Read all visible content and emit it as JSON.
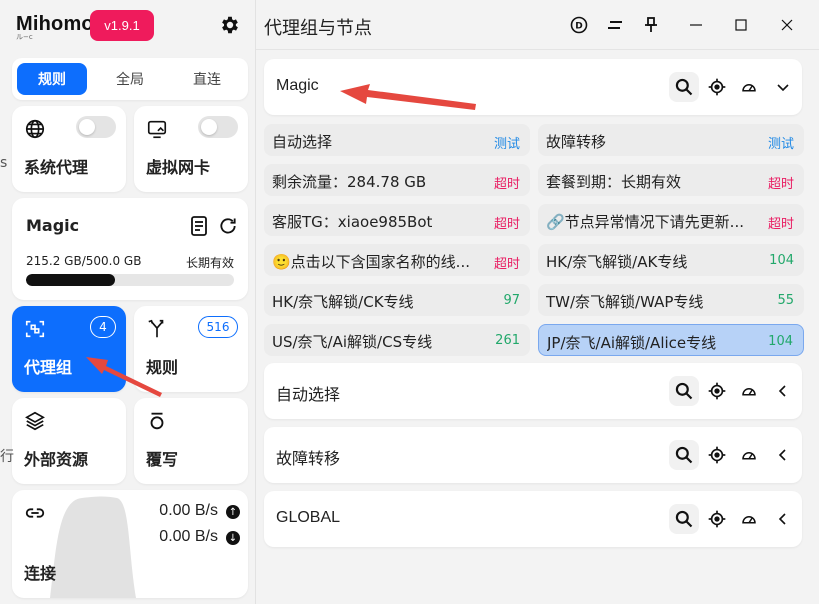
{
  "app": {
    "brand": "Mihomo",
    "brand_sub": "ル−c",
    "version": "v1.9.1"
  },
  "modes": [
    {
      "label": "规则",
      "active": true
    },
    {
      "label": "全局",
      "active": false
    },
    {
      "label": "直连",
      "active": false
    }
  ],
  "system_proxy": {
    "label": "系统代理",
    "enabled": false
  },
  "tun": {
    "label": "虚拟网卡",
    "enabled": false
  },
  "subscription": {
    "name": "Magic",
    "usage": "215.2 GB/500.0 GB",
    "expire": "长期有效",
    "used_fraction": 0.43
  },
  "proxy_groups_card": {
    "label": "代理组",
    "count": "4"
  },
  "rules_card": {
    "label": "规则",
    "count": "516"
  },
  "resources_card": {
    "label": "外部资源"
  },
  "override_card": {
    "label": "覆写"
  },
  "connections_card": {
    "label": "连接",
    "upload": "0.00 B/s",
    "download": "0.00 B/s"
  },
  "left_edge_fragments": [
    "s",
    "行"
  ],
  "header": {
    "title": "代理组与节点"
  },
  "groups": [
    {
      "name": "Magic",
      "expanded": true
    },
    {
      "name": "自动选择",
      "expanded": false
    },
    {
      "name": "故障转移",
      "expanded": false
    },
    {
      "name": "GLOBAL",
      "expanded": false
    }
  ],
  "nodes": [
    {
      "name": "自动选择",
      "delay": "测试",
      "delay_color": "#1e88e5",
      "selected": false
    },
    {
      "name": "故障转移",
      "delay": "测试",
      "delay_color": "#1e88e5",
      "selected": false
    },
    {
      "name": "剩余流量：284.78 GB",
      "delay": "超时",
      "delay_color": "#e91e63",
      "selected": false
    },
    {
      "name": "套餐到期：长期有效",
      "delay": "超时",
      "delay_color": "#e91e63",
      "selected": false
    },
    {
      "name": "客服TG：xiaoe985Bot",
      "delay": "超时",
      "delay_color": "#e91e63",
      "selected": false
    },
    {
      "name": "🔗节点异常情况下请先更新...",
      "delay": "超时",
      "delay_color": "#e91e63",
      "selected": false
    },
    {
      "name": "🙂点击以下含国家名称的线...",
      "delay": "超时",
      "delay_color": "#e91e63",
      "selected": false
    },
    {
      "name": "HK/奈飞解锁/AK专线",
      "delay": "104",
      "delay_color": "#22a86b",
      "selected": false
    },
    {
      "name": "HK/奈飞解锁/CK专线",
      "delay": "97",
      "delay_color": "#22a86b",
      "selected": false
    },
    {
      "name": "TW/奈飞解锁/WAP专线",
      "delay": "55",
      "delay_color": "#22a86b",
      "selected": false
    },
    {
      "name": "US/奈飞/Ai解锁/CS专线",
      "delay": "261",
      "delay_color": "#22a86b",
      "selected": false
    },
    {
      "name": "JP/奈飞/Ai解锁/Alice专线",
      "delay": "104",
      "delay_color": "#22a86b",
      "selected": true
    }
  ],
  "colors": {
    "accent": "#0d6efd",
    "version_badge": "#ef1b5c",
    "annotation_arrow": "#e5483f"
  }
}
